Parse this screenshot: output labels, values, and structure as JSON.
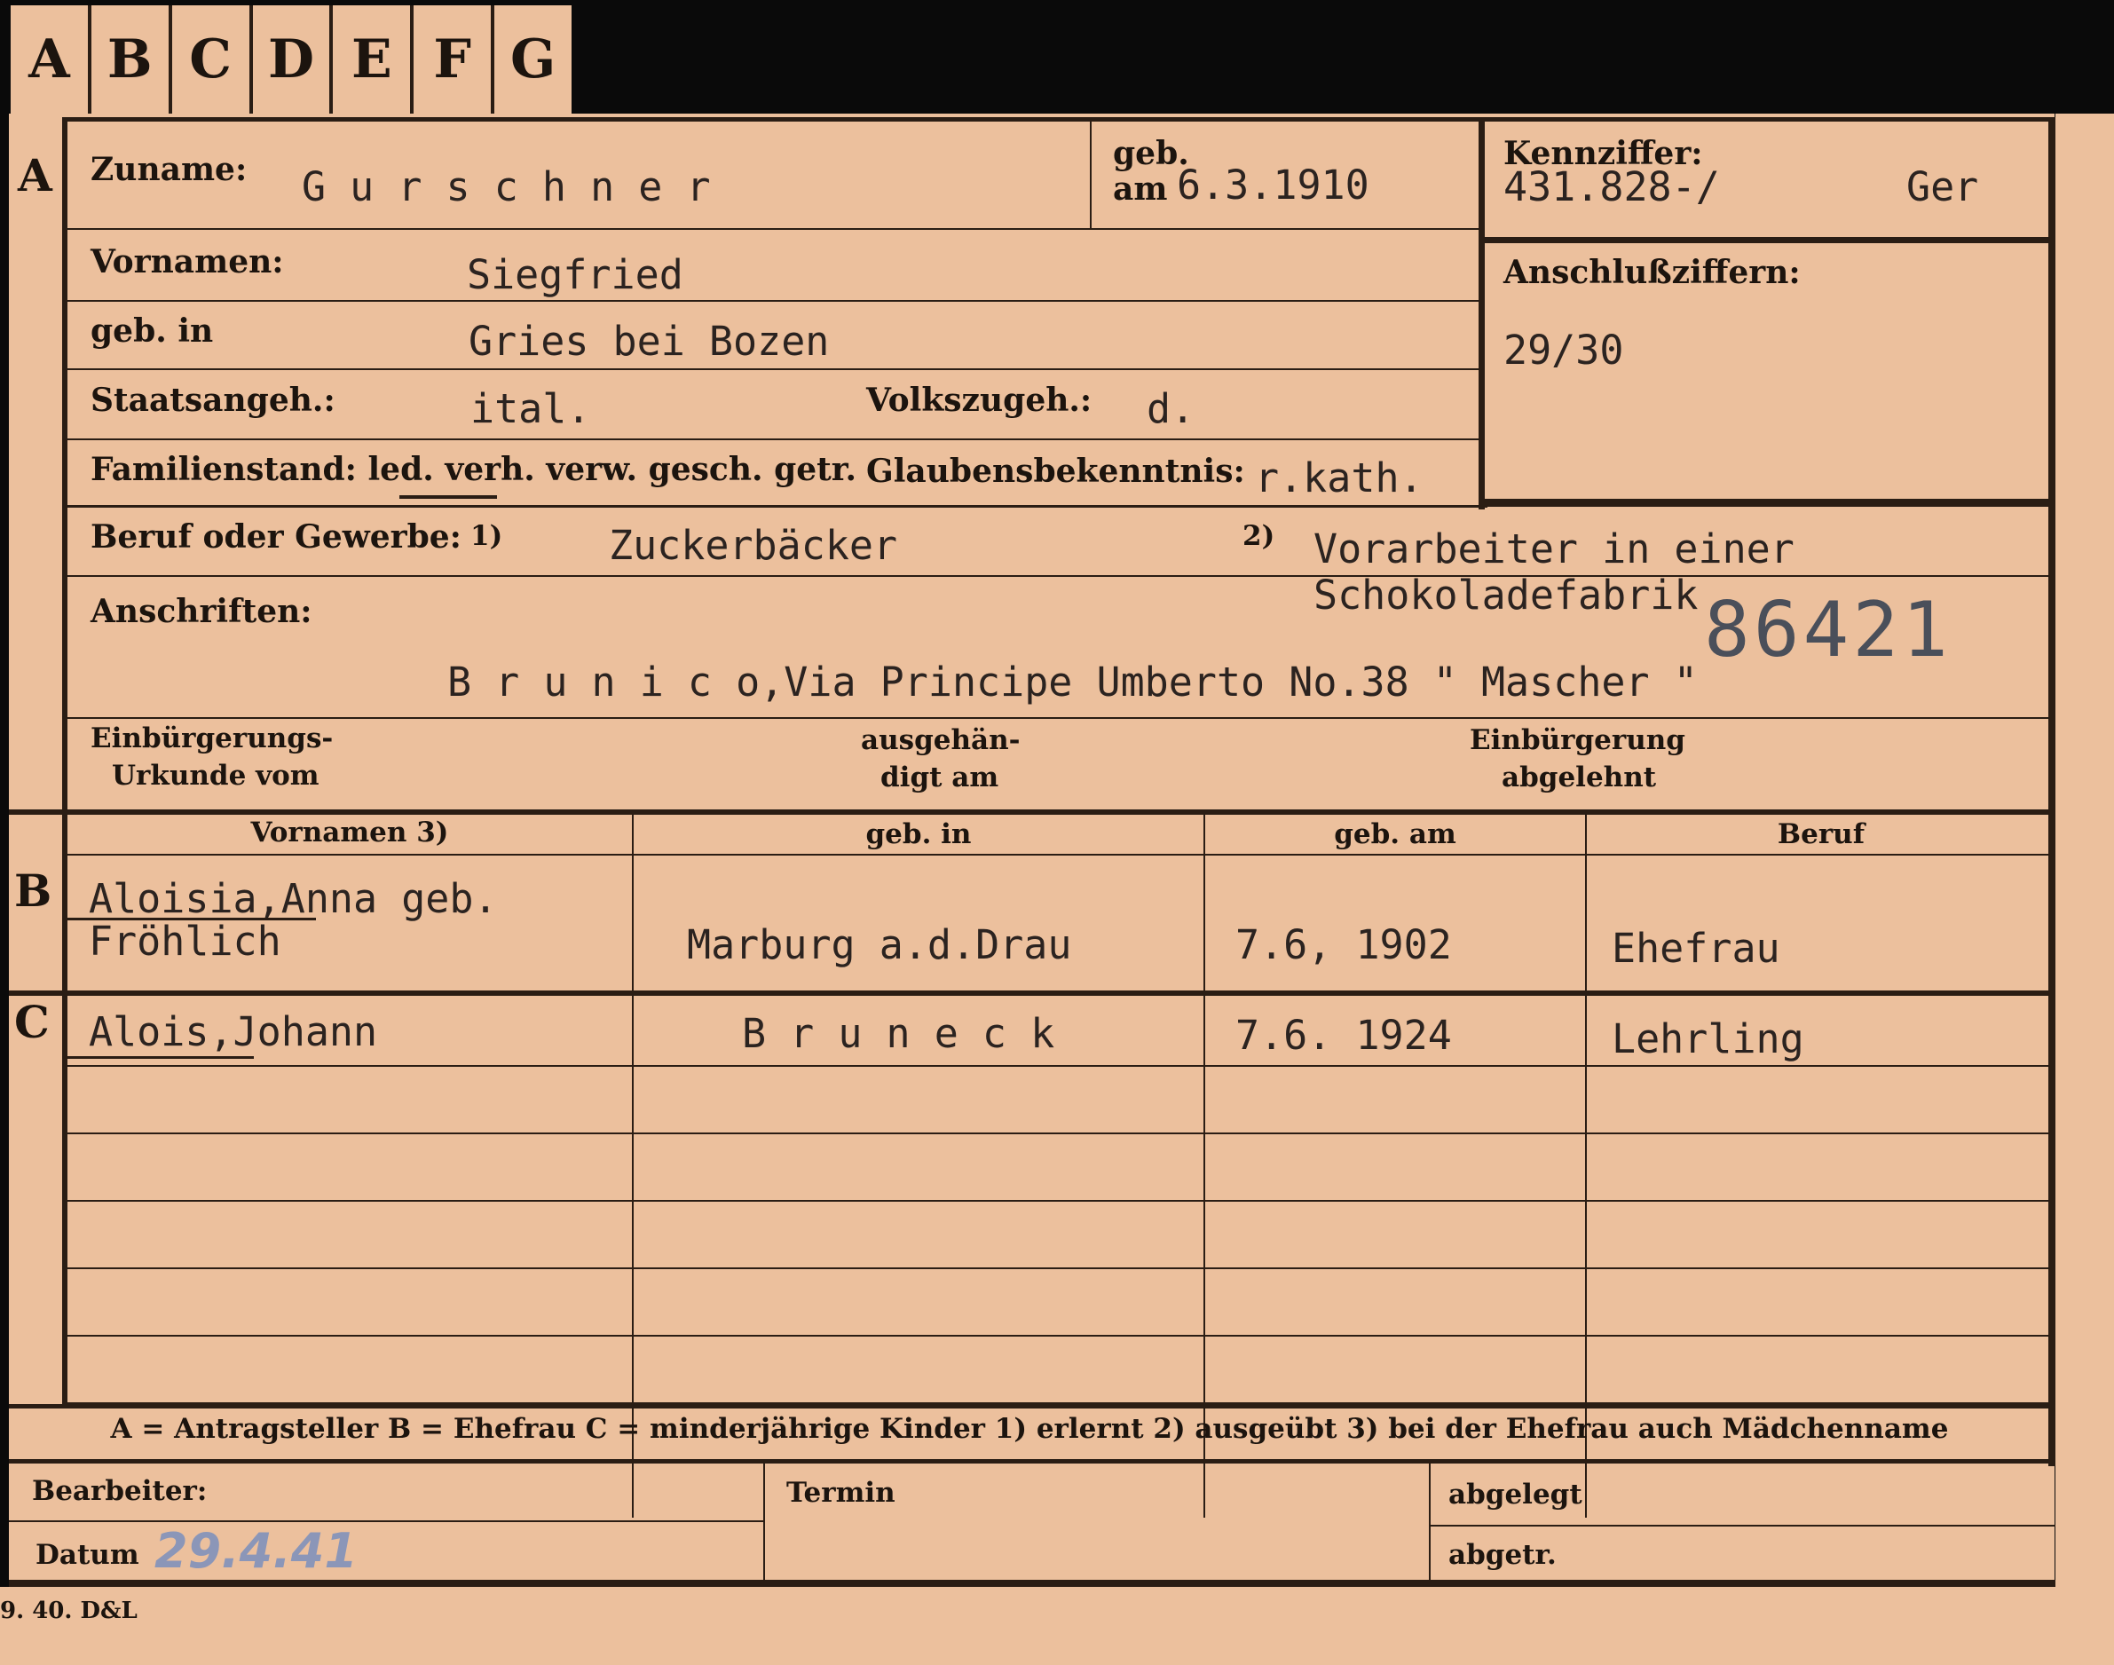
{
  "tabs": [
    "A",
    "B",
    "C",
    "D",
    "E",
    "F",
    "G"
  ],
  "section_a": {
    "marker": "A",
    "zuname_label": "Zuname:",
    "zuname": "G u r s c h n e r",
    "geb_label": "geb.",
    "am_label": "am",
    "geb_date": "6.3.1910",
    "kennziffer_label": "Kennziffer:",
    "kennziffer": "431.828-/",
    "kennziffer_suffix": "Ger",
    "vornamen_label": "Vornamen:",
    "vornamen": "Siegfried",
    "geb_in_label": "geb. in",
    "geb_in": "Gries bei Bozen",
    "anschluss_label": "Anschlußziffern:",
    "anschluss": "29/30",
    "staats_label": "Staatsangeh.:",
    "staats": "ital.",
    "volks_label": "Volkszugeh.:",
    "volks": "d.",
    "familienstand_label": "Familienstand: led. verh. verw. gesch. getr.",
    "glauben_label": "Glaubensbekenntnis:",
    "glauben": "r.kath.",
    "beruf_label": "Beruf oder Gewerbe:",
    "beruf_note1": "1)",
    "beruf1": "Zuckerbäcker",
    "beruf_note2": "2)",
    "beruf2_line1": "Vorarbeiter  in einer",
    "beruf2_line2": "Schokoladefabrik",
    "stamp_number": "86421",
    "anschriften_label": "Anschriften:",
    "anschrift": "B r u n i c o,Via Principe Umberto No.38 \" Mascher \"",
    "einb_urkunde_line1": "Einbürgerungs-",
    "einb_urkunde_line2": "Urkunde vom",
    "ausgehaendigt_line1": "ausgehän-",
    "ausgehaendigt_line2": "digt am",
    "einb_abgelehnt_line1": "Einbürgerung",
    "einb_abgelehnt_line2": "abgelehnt"
  },
  "table": {
    "headers": [
      "Vornamen 3)",
      "geb. in",
      "geb. am",
      "Beruf"
    ],
    "section_b_marker": "B",
    "section_c_marker": "C",
    "row_b": {
      "vornamen_line1": "Aloisia,Anna geb.",
      "vornamen_line2": "Fröhlich",
      "geb_in": "Marburg a.d.Drau",
      "geb_am": "7.6, 1902",
      "beruf": "Ehefrau"
    },
    "row_c": {
      "vornamen": "Alois,Johann",
      "geb_in": "B r u n e c k",
      "geb_am": "7.6. 1924",
      "beruf": "Lehrling"
    }
  },
  "legend": "A = Antragsteller   B = Ehefrau   C = minderjährige Kinder   1) erlernt   2) ausgeübt   3) bei der Ehefrau auch Mädchenname",
  "footer": {
    "bearbeiter_label": "Bearbeiter:",
    "datum_label": "Datum",
    "datum_value": "29.4.41",
    "termin_label": "Termin",
    "abgelegt_label": "abgelegt",
    "abgetr_label": "abgetr."
  },
  "print_code": "9. 40. D&L",
  "colors": {
    "paper": "#ecc09d",
    "ink": "#2a1d14",
    "pencil": "#8b96b8",
    "stamp": "#4a4f5a"
  }
}
